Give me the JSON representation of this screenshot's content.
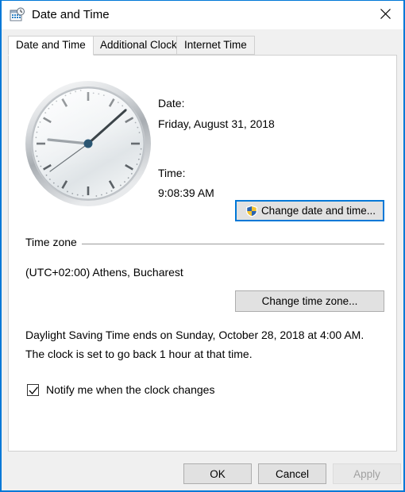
{
  "window": {
    "title": "Date and Time",
    "icon": "calendar-clock-icon",
    "close_label": "✕",
    "border_color": "#0078d7"
  },
  "tabs": [
    {
      "label": "Date and Time",
      "active": true
    },
    {
      "label": "Additional Clocks",
      "active": false
    },
    {
      "label": "Internet Time",
      "active": false
    }
  ],
  "main": {
    "clock": {
      "icon": "analog-clock-icon",
      "hour": 9,
      "minute": 8,
      "second": 39
    },
    "date_label": "Date:",
    "date_value": "Friday, August 31, 2018",
    "time_label": "Time:",
    "time_value": "9:08:39 AM",
    "change_date_time_button": {
      "label": "Change date and time...",
      "icon": "uac-shield-icon",
      "focused": true
    },
    "timezone": {
      "group_label": "Time zone",
      "value": "(UTC+02:00) Athens, Bucharest",
      "change_button_label": "Change time zone..."
    },
    "dst": {
      "line_1": "Daylight Saving Time ends on Sunday, October 28, 2018 at 4:00 AM.",
      "line_2": "The clock is set to go back 1 hour at that time."
    },
    "notify": {
      "label": "Notify me when the clock changes",
      "checked": true
    }
  },
  "footer": {
    "ok_label": "OK",
    "cancel_label": "Cancel",
    "apply_label": "Apply",
    "apply_disabled": true
  }
}
